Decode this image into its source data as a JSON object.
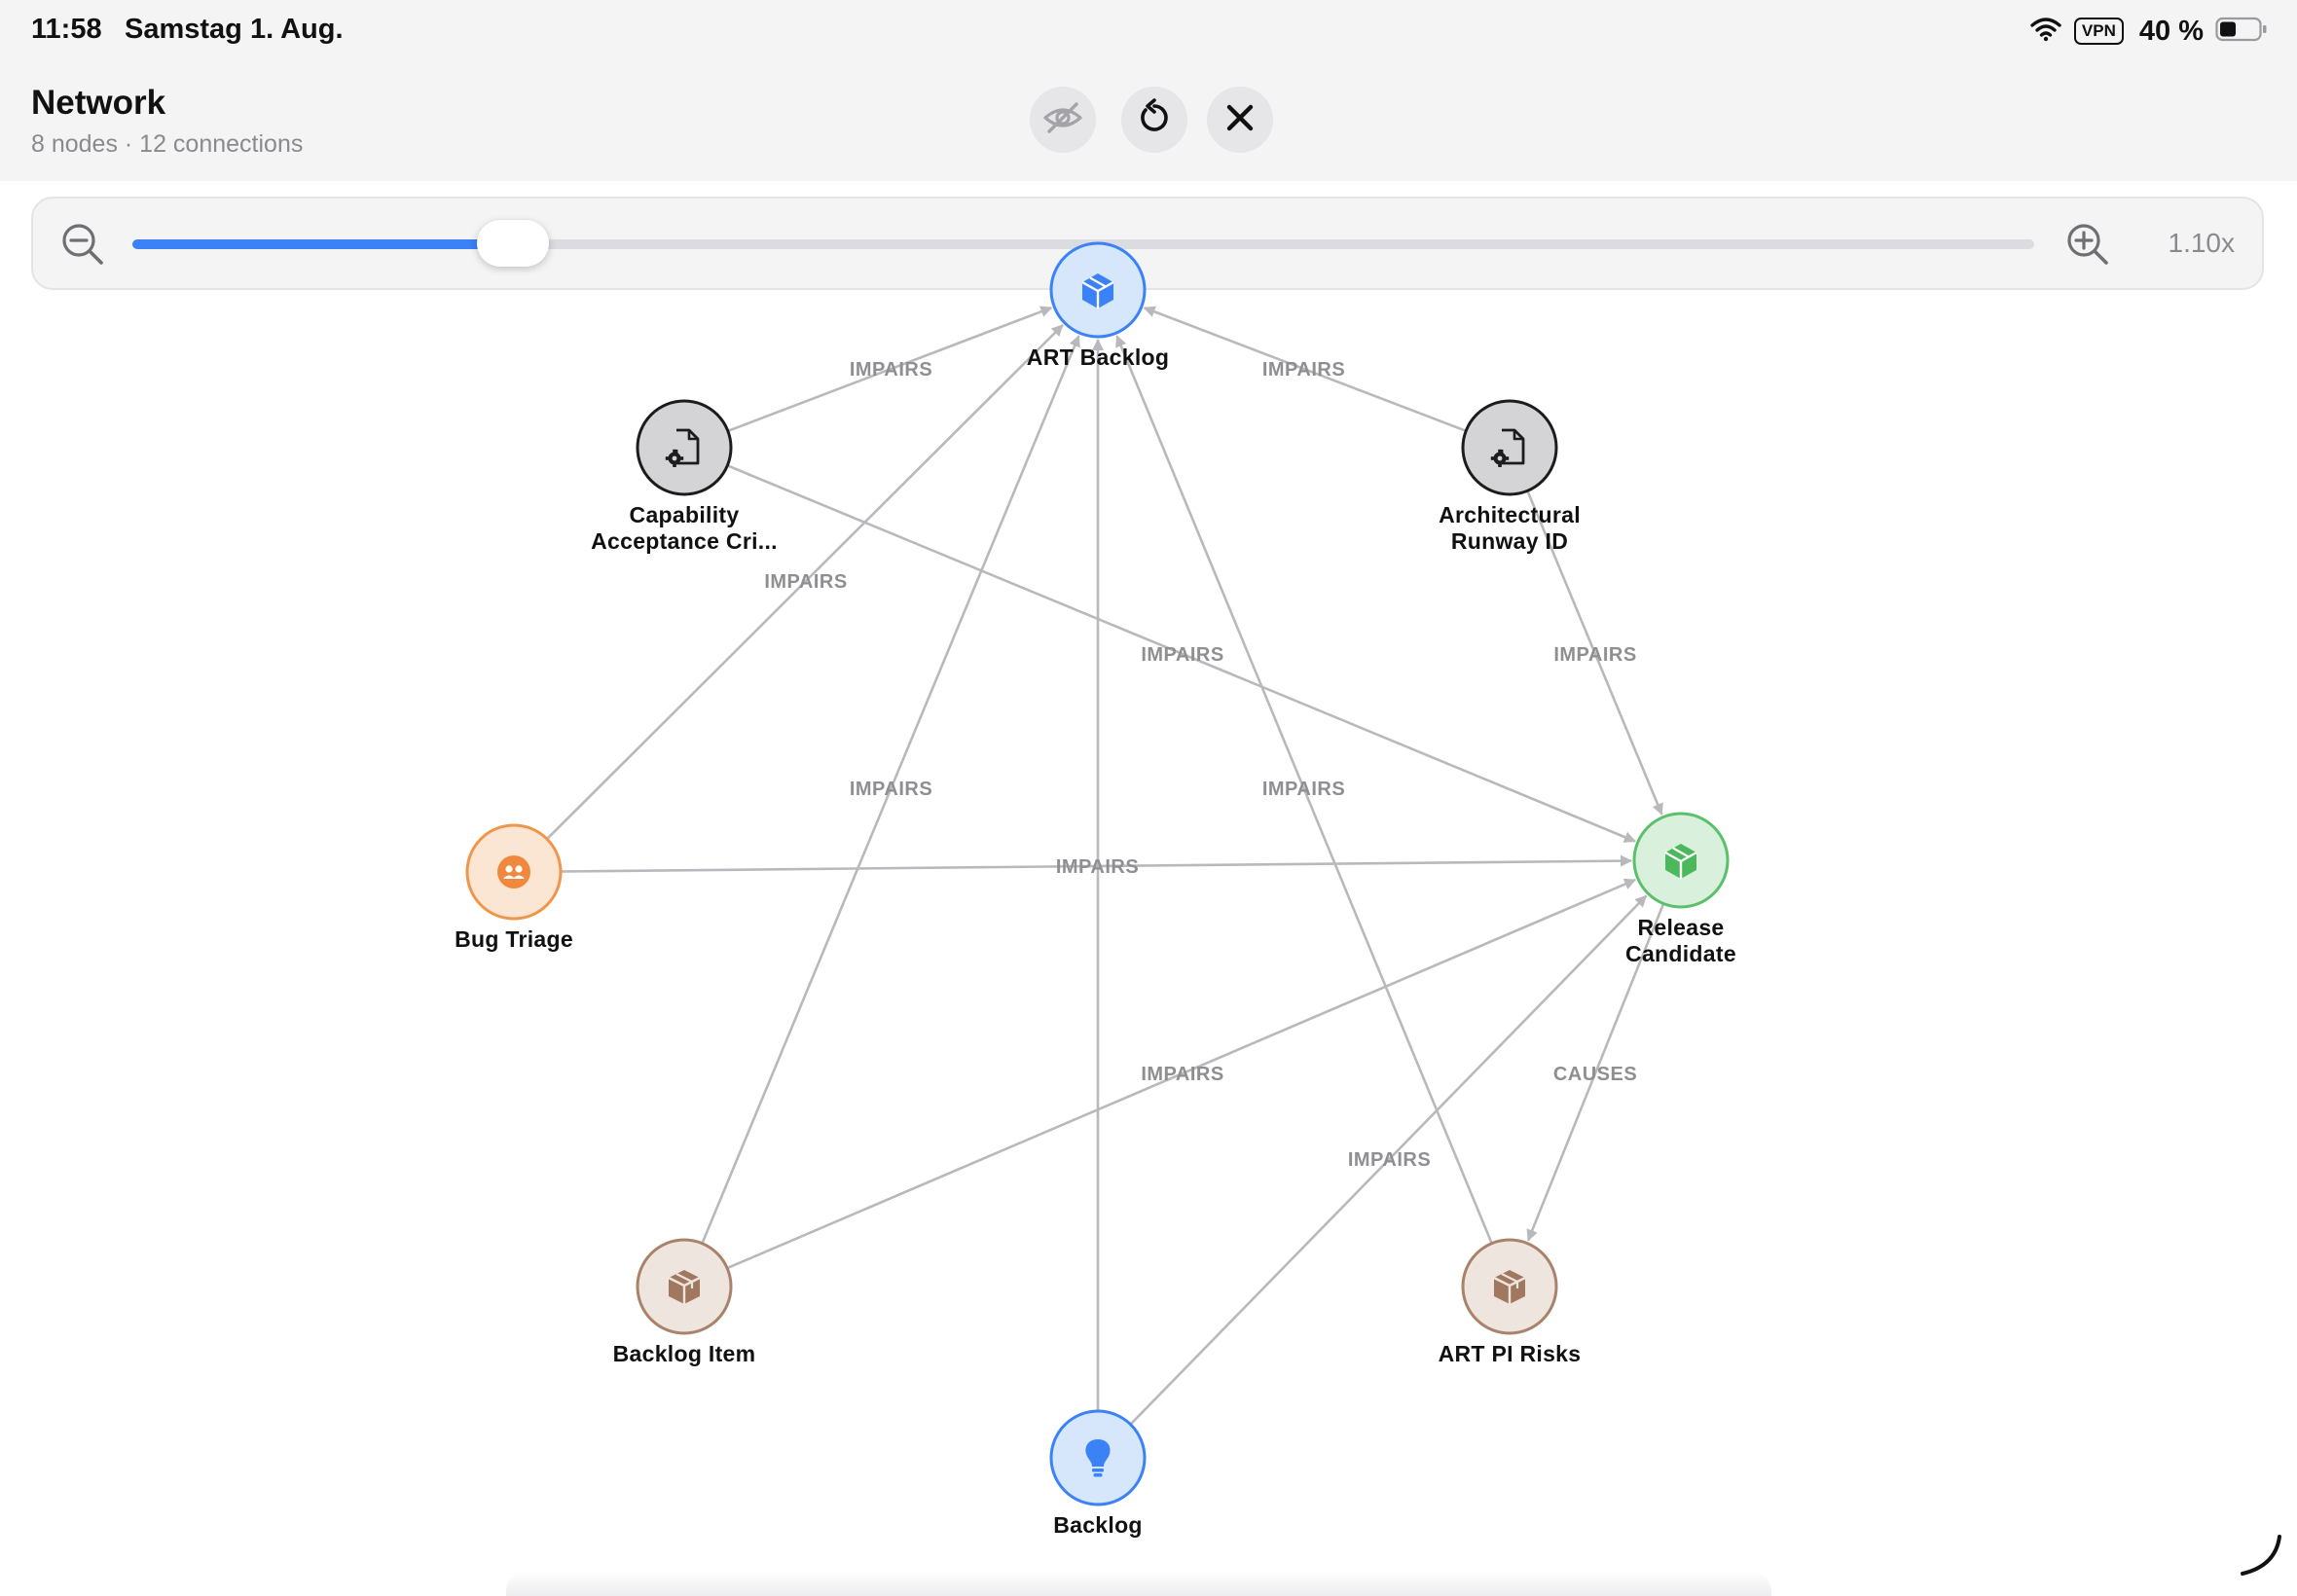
{
  "status_bar": {
    "time": "11:58",
    "date": "Samstag 1. Aug.",
    "vpn": "VPN",
    "battery": "40 %"
  },
  "header": {
    "title": "Network",
    "subtitle": "8 nodes · 12 connections"
  },
  "zoom": {
    "value_label": "1.10x",
    "slider_fraction": 0.2
  },
  "colors": {
    "accent": "#3b82f6",
    "edge": "#b9b9bd",
    "edge_label": "#8e8e93"
  },
  "graph": {
    "nodes": [
      {
        "id": "art-backlog",
        "label_lines": [
          "ART Backlog"
        ],
        "icon": "cube-icon",
        "stroke": "#3b82f6",
        "fill": "#d6e6fb",
        "icon_color": "#3b82f6"
      },
      {
        "id": "capability",
        "label_lines": [
          "Capability",
          "Acceptance Cri..."
        ],
        "icon": "document-gear-icon",
        "stroke": "#1c1c1e",
        "fill": "#d4d4d6",
        "icon_color": "#1c1c1e"
      },
      {
        "id": "architectural",
        "label_lines": [
          "Architectural",
          "Runway ID"
        ],
        "icon": "document-gear-icon",
        "stroke": "#1c1c1e",
        "fill": "#d4d4d6",
        "icon_color": "#1c1c1e"
      },
      {
        "id": "bug-triage",
        "label_lines": [
          "Bug Triage"
        ],
        "icon": "people-icon",
        "stroke": "#f0964b",
        "fill": "#fbe6d4",
        "icon_color": "#f0883e"
      },
      {
        "id": "release",
        "label_lines": [
          "Release",
          "Candidate"
        ],
        "icon": "cube-icon",
        "stroke": "#5cbf6a",
        "fill": "#d9f1dc",
        "icon_color": "#4cb85c"
      },
      {
        "id": "backlog-item",
        "label_lines": [
          "Backlog Item"
        ],
        "icon": "box-icon",
        "stroke": "#a9826a",
        "fill": "#efe5df",
        "icon_color": "#a07860"
      },
      {
        "id": "art-pi-risks",
        "label_lines": [
          "ART PI Risks"
        ],
        "icon": "box-icon",
        "stroke": "#a9826a",
        "fill": "#efe5df",
        "icon_color": "#a07860"
      },
      {
        "id": "backlog",
        "label_lines": [
          "Backlog"
        ],
        "icon": "lightbulb-icon",
        "stroke": "#3b82f6",
        "fill": "#d6e6fb",
        "icon_color": "#3b82f6"
      }
    ],
    "edges": [
      {
        "from": "capability",
        "to": "art-backlog",
        "label": "IMPAIRS"
      },
      {
        "from": "architectural",
        "to": "art-backlog",
        "label": "IMPAIRS"
      },
      {
        "from": "bug-triage",
        "to": "art-backlog",
        "label": "IMPAIRS"
      },
      {
        "from": "capability",
        "to": "release",
        "label": "IMPAIRS"
      },
      {
        "from": "architectural",
        "to": "release",
        "label": "IMPAIRS"
      },
      {
        "from": "backlog-item",
        "to": "art-backlog",
        "label": "IMPAIRS"
      },
      {
        "from": "art-pi-risks",
        "to": "art-backlog",
        "label": "IMPAIRS"
      },
      {
        "from": "bug-triage",
        "to": "release",
        "label": "IMPAIRS"
      },
      {
        "from": "backlog-item",
        "to": "release",
        "label": "IMPAIRS"
      },
      {
        "from": "release",
        "to": "art-pi-risks",
        "label": "CAUSES"
      },
      {
        "from": "backlog",
        "to": "release",
        "label": "IMPAIRS"
      },
      {
        "from": "backlog",
        "to": "art-backlog",
        "label": ""
      }
    ]
  }
}
